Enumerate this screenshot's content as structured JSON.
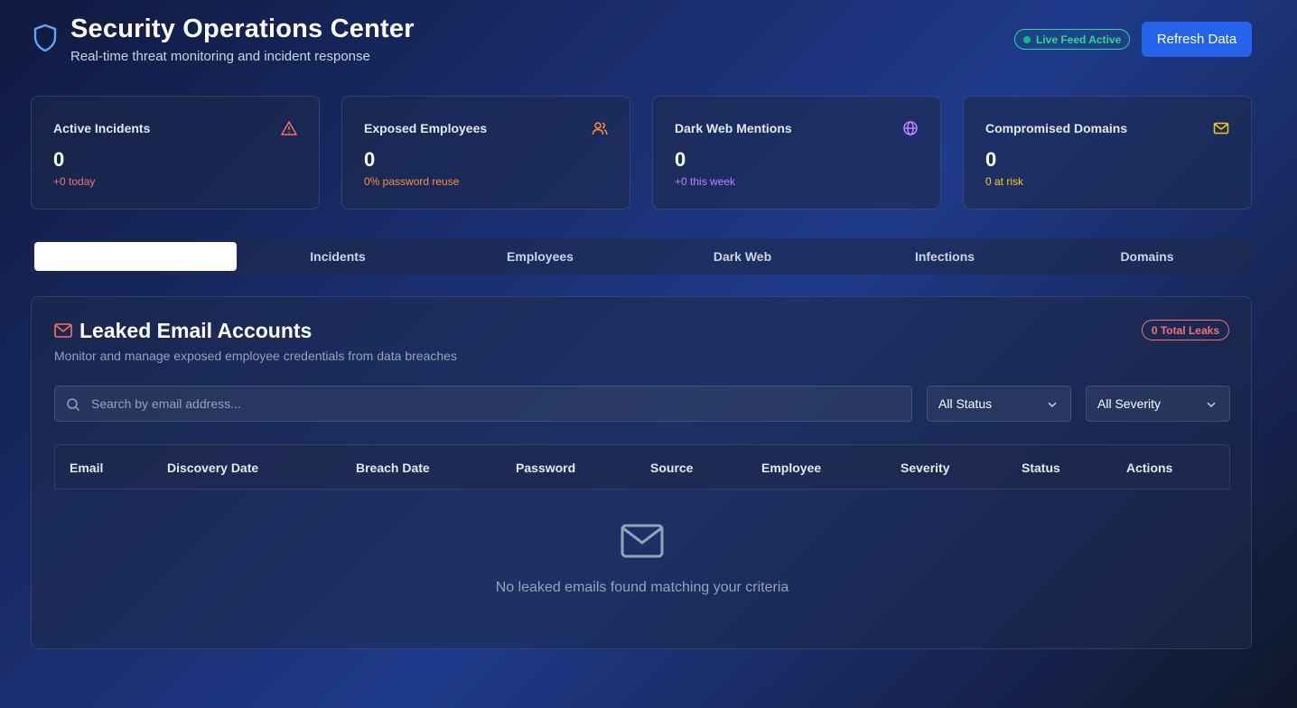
{
  "header": {
    "title": "Security Operations Center",
    "subtitle": "Real-time threat monitoring and incident response",
    "live_badge": "Live Feed Active",
    "refresh_label": "Refresh Data"
  },
  "stats": [
    {
      "label": "Active Incidents",
      "value": "0",
      "sub": "+0 today",
      "icon": "alert-triangle-icon",
      "color": "#f87171"
    },
    {
      "label": "Exposed Employees",
      "value": "0",
      "sub": "0% password reuse",
      "icon": "users-icon",
      "color": "#fb923c"
    },
    {
      "label": "Dark Web Mentions",
      "value": "0",
      "sub": "+0 this week",
      "icon": "globe-icon",
      "color": "#c084fc"
    },
    {
      "label": "Compromised Domains",
      "value": "0",
      "sub": "0 at risk",
      "icon": "mail-icon",
      "color": "#facc15"
    }
  ],
  "tabs": [
    "",
    "Incidents",
    "Employees",
    "Dark Web",
    "Infections",
    "Domains"
  ],
  "panel": {
    "title": "Leaked Email Accounts",
    "description": "Monitor and manage exposed employee credentials from data breaches",
    "badge": "0 Total Leaks",
    "search_placeholder": "Search by email address...",
    "status_filter": "All Status",
    "severity_filter": "All Severity",
    "columns": [
      "Email",
      "Discovery Date",
      "Breach Date",
      "Password",
      "Source",
      "Employee",
      "Severity",
      "Status",
      "Actions"
    ],
    "empty_message": "No leaked emails found matching your criteria"
  }
}
